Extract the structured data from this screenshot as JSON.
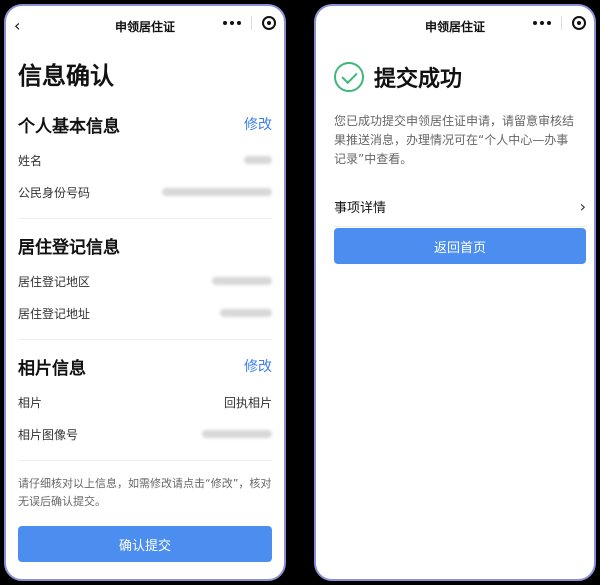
{
  "left": {
    "nav_title": "申领居住证",
    "back_glyph": "‹",
    "page_title": "信息确认",
    "sections": {
      "personal": {
        "title": "个人基本信息",
        "edit": "修改",
        "fields": [
          {
            "label": "姓名"
          },
          {
            "label": "公民身份号码"
          }
        ]
      },
      "residence": {
        "title": "居住登记信息",
        "fields": [
          {
            "label": "居住登记地区"
          },
          {
            "label": "居住登记地址"
          }
        ]
      },
      "photo": {
        "title": "相片信息",
        "edit": "修改",
        "fields": [
          {
            "label": "相片",
            "value": "回执相片"
          },
          {
            "label": "相片图像号"
          }
        ]
      }
    },
    "notice": "请仔细核对以上信息，如需修改请点击“修改”，核对无误后确认提交。",
    "confirm_button": "确认提交"
  },
  "right": {
    "nav_title": "申领居住证",
    "success_title": "提交成功",
    "success_desc": "您已成功提交申领居住证申请，请留意审核结果推送消息，办理情况可在“个人中心—办事记录”中查看。",
    "detail_label": "事项详情",
    "home_button": "返回首页"
  },
  "colors": {
    "accent": "#4c8ef0",
    "link": "#3c7ef0",
    "success": "#3cb878",
    "frame": "#8b8fd6"
  },
  "icons": [
    "back-icon",
    "more-icon",
    "target-icon",
    "check-circle-icon",
    "chevron-right-icon"
  ]
}
